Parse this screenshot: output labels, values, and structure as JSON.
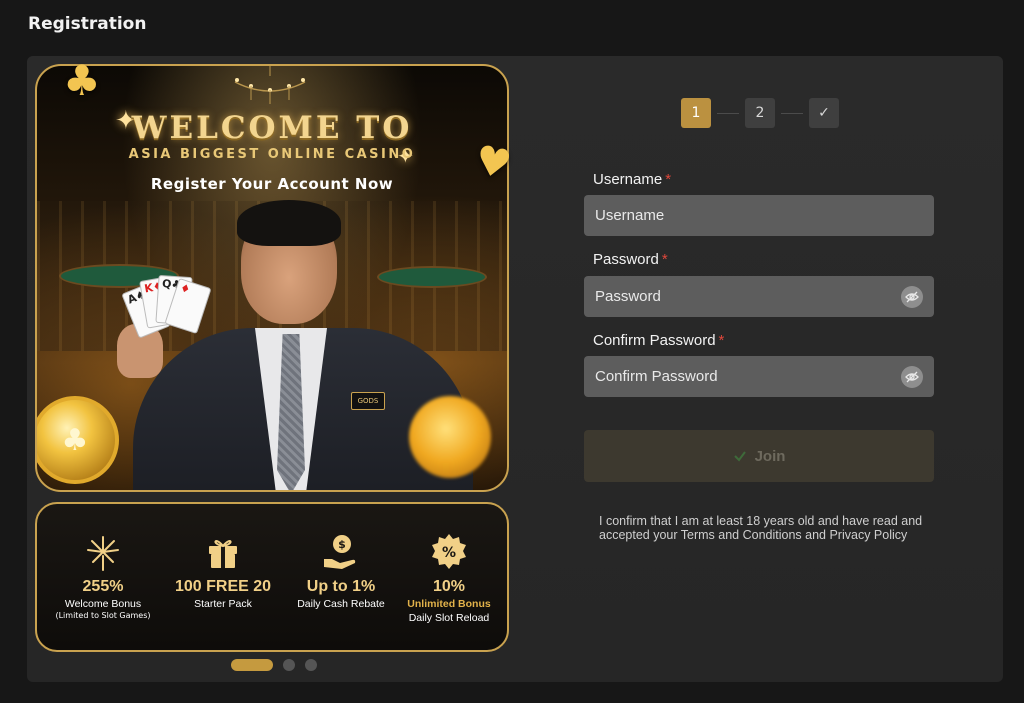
{
  "page": {
    "title": "Registration"
  },
  "banner": {
    "title": "WELCOME TO",
    "subtitle": "ASIA BIGGEST ONLINE CASINO",
    "tagline": "Register Your Account Now",
    "badge": "GODS"
  },
  "features": [
    {
      "icon": "fireworks-icon",
      "value": "255%",
      "label": "Welcome Bonus",
      "note": "(Limited to Slot Games)"
    },
    {
      "icon": "gift-icon",
      "value": "100 FREE 20",
      "label": "Starter Pack"
    },
    {
      "icon": "cash-hand-icon",
      "value": "Up to 1%",
      "label": "Daily Cash Rebate"
    },
    {
      "icon": "percent-badge-icon",
      "value": "10%",
      "label_highlight": "Unlimited Bonus",
      "label": "Daily Slot Reload"
    }
  ],
  "carousel": {
    "active_index": 0,
    "count": 3
  },
  "stepper": {
    "steps": [
      "1",
      "2",
      "✓"
    ],
    "active": 0
  },
  "form": {
    "username": {
      "label": "Username",
      "required_mark": "*",
      "placeholder": "Username"
    },
    "password": {
      "label": "Password",
      "required_mark": "*",
      "placeholder": "Password"
    },
    "confirm_password": {
      "label": "Confirm Password",
      "required_mark": "*",
      "placeholder": "Confirm Password"
    },
    "join_label": "Join",
    "consent_text": "I confirm that I am at least 18 years old and have read and accepted your Terms and Conditions and Privacy Policy"
  },
  "colors": {
    "accent_gold": "#bb9140",
    "required_red": "#e0473b",
    "input_bg": "#5d5d5d",
    "join_disabled_bg": "#3d392f"
  }
}
